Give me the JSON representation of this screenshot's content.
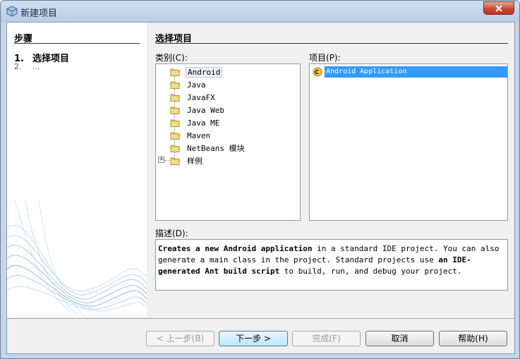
{
  "window": {
    "title": "新建项目"
  },
  "steps": {
    "title": "步骤",
    "items": [
      {
        "num": "1.",
        "label": "选择项目"
      },
      {
        "num": "2.",
        "label": "..."
      }
    ]
  },
  "main": {
    "title": "选择项目",
    "categories_label": "类别(C):",
    "projects_label": "项目(P):",
    "description_label": "描述(D):"
  },
  "categories": [
    {
      "label": "Android"
    },
    {
      "label": "Java"
    },
    {
      "label": "JavaFX"
    },
    {
      "label": "Java Web"
    },
    {
      "label": "Java ME"
    },
    {
      "label": "Maven"
    },
    {
      "label": "NetBeans 模块"
    },
    {
      "label": "样例"
    }
  ],
  "projects": [
    {
      "label": "Android Application"
    }
  ],
  "description": {
    "p1": "Creates a new Android application",
    "p2": " in a standard IDE project. You can also generate a main class in the project. Standard projects use ",
    "p3": "an IDE-generated Ant build script",
    "p4": " to build, run, and debug your project."
  },
  "buttons": {
    "back": "< 上一步(B)",
    "next": "下一步 >",
    "finish": "完成(F)",
    "cancel": "取消",
    "help": "帮助(H)"
  },
  "colors": {
    "selection": "#3399ff",
    "folder": "#e8c25a"
  }
}
